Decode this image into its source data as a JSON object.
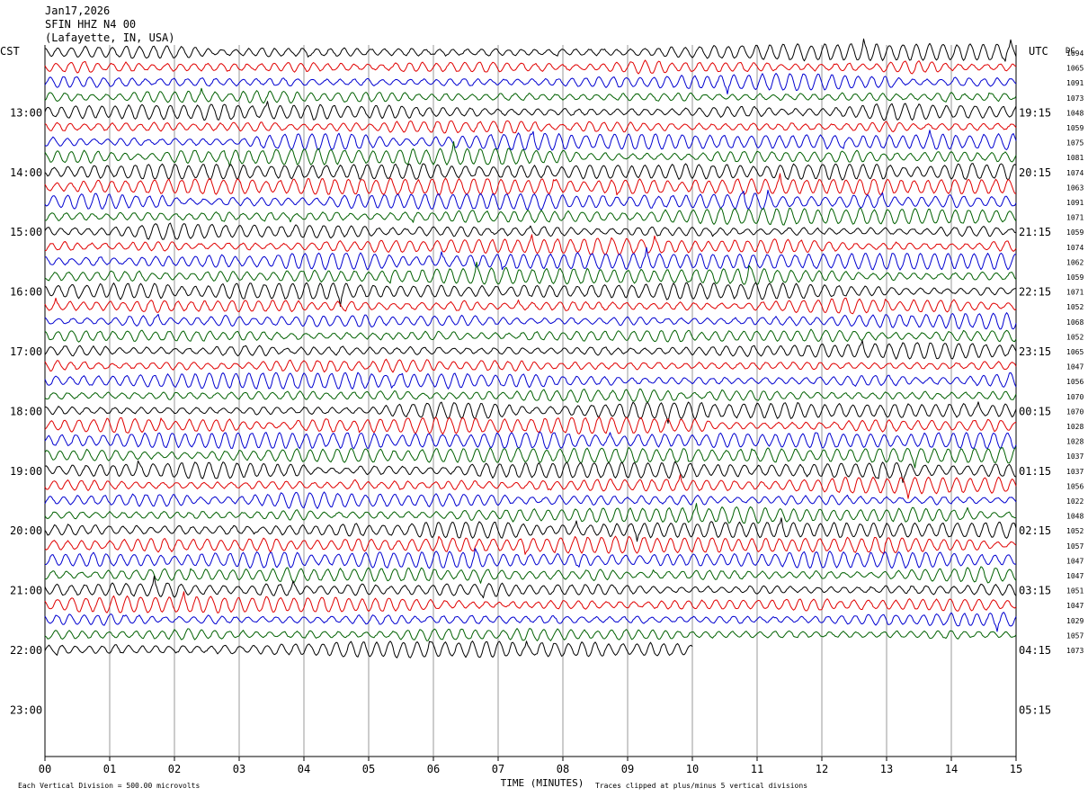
{
  "header": {
    "date": "Jan17,2026",
    "station": "SFIN HHZ N4 00",
    "location": "(Lafayette, IN, USA)"
  },
  "left_axis_label": "CST",
  "right_axis_label": "UTC",
  "dc_label": "DC",
  "footer": {
    "xlabel": "TIME (MINUTES)",
    "scale_note": "Each Vertical Division =  500.00 microvolts",
    "clip_note": "Traces clipped at plus/minus 5 vertical divisions"
  },
  "colors": {
    "trace_cycle": [
      "#000000",
      "#e00000",
      "#0000d0",
      "#006000"
    ],
    "grid": "#808080"
  },
  "chart_data": {
    "type": "line",
    "description_of_axes": "helicorder: rows every 15 min, x = minutes within row",
    "x_range": [
      0,
      15
    ],
    "x_ticks": [
      "00",
      "01",
      "02",
      "03",
      "04",
      "05",
      "06",
      "07",
      "08",
      "09",
      "10",
      "11",
      "12",
      "13",
      "14",
      "15"
    ],
    "left_hour_labels": [
      "13:00",
      "14:00",
      "15:00",
      "16:00",
      "17:00",
      "18:00",
      "19:00",
      "20:00",
      "21:00",
      "22:00",
      "23:00"
    ],
    "right_hour_labels": [
      "19:15",
      "20:15",
      "21:15",
      "22:15",
      "23:15",
      "00:15",
      "01:15",
      "02:15",
      "03:15",
      "04:15",
      "05:15"
    ],
    "rows_per_hour": 4,
    "first_row_time_cst": "12:00",
    "dc_offsets": [
      "1094",
      "1065",
      "1091",
      "1073",
      "1048",
      "1059",
      "1075",
      "1081",
      "1074",
      "1063",
      "1091",
      "1071",
      "1059",
      "1074",
      "1062",
      "1059",
      "1071",
      "1052",
      "1068",
      "1052",
      "1065",
      "1047",
      "1056",
      "1070",
      "1070",
      "1028",
      "1028",
      "1037",
      "1037",
      "1056",
      "1022",
      "1048",
      "1052",
      "1057",
      "1047",
      "1047",
      "1051",
      "1047",
      "1029",
      "1057",
      "1073"
    ],
    "last_row_end_minute": 10.0
  }
}
